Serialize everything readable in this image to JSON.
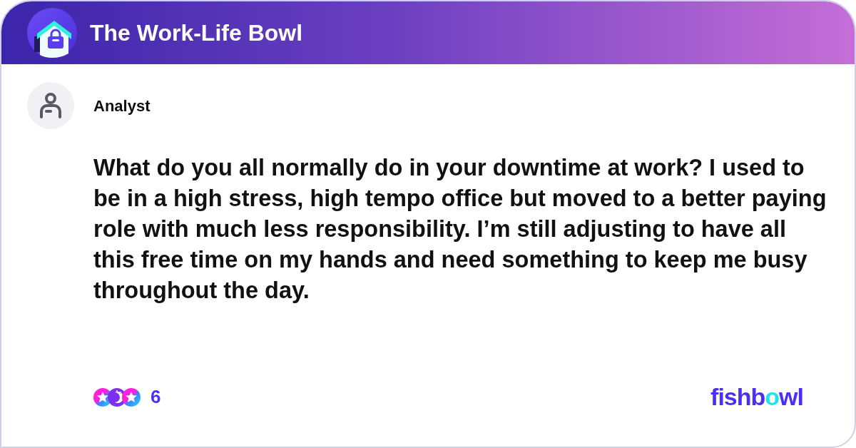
{
  "header": {
    "title": "The Work-Life Bowl"
  },
  "post": {
    "author": "Analyst",
    "body": "What do you all normally do in your downtime at work? I used to be in a high stress, high tempo office but moved to a better paying role with much less responsibility. I’m still adjusting to have all this free time on my hands and need something to keep me busy throughout the day."
  },
  "reactions": {
    "count": "6"
  },
  "brand": {
    "parts": [
      {
        "text": "fishb",
        "color": "#4b2ff5"
      },
      {
        "text": "o",
        "color": "#1fe3e8"
      },
      {
        "text": "wl",
        "color": "#4b2ff5"
      }
    ]
  }
}
